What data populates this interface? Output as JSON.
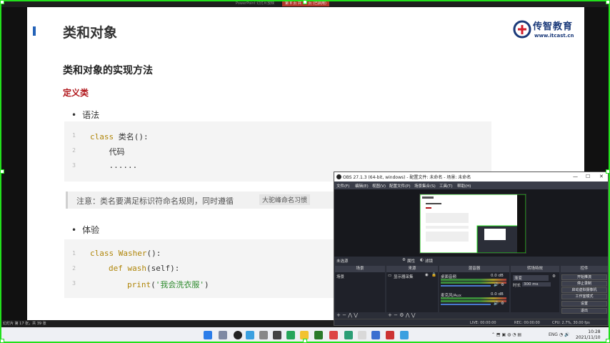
{
  "ppt": {
    "window_title": "PowerPoint 幻灯片放映",
    "active_tab": "第 8 页 共 39 页 (已启用)",
    "status": "幻灯片 第 17 张，共 39 张"
  },
  "slide": {
    "title": "类和对象",
    "logo_main": "传智教育",
    "logo_url": "www.itcast.cn",
    "heading": "类和对象的实现方法",
    "subheading": "定义类",
    "bullet_syntax": "语法",
    "code1": {
      "lines": [
        {
          "num": "1",
          "kw": "class ",
          "rest": "类名():"
        },
        {
          "num": "2",
          "kw": "",
          "rest": "    代码"
        },
        {
          "num": "3",
          "kw": "",
          "rest": "    ......"
        }
      ]
    },
    "note_text": "注意：类名要满足标识符命名规则，同时遵循",
    "note_tag": "大驼峰命名习惯",
    "bullet_experience": "体验",
    "code2": {
      "line1_num": "1",
      "line1_kw": "class ",
      "line1_name": "Washer",
      "line1_rest": "():",
      "line2_num": "2",
      "line2_kw": "def ",
      "line2_name": "wash",
      "line2_rest": "(self):",
      "line3_num": "3",
      "line3_fn": "print",
      "line3_open": "(",
      "line3_str": "'我会洗衣服'",
      "line3_close": ")"
    }
  },
  "obs": {
    "title": "OBS 27.1.3 (64-bit, windows) - 配置文件: 未命名 - 场景: 未命名",
    "menu": [
      "文件(F)",
      "编辑(E)",
      "视图(V)",
      "配置文件(P)",
      "场景集合(S)",
      "工具(T)",
      "帮助(H)"
    ],
    "toolbar_source": "未选源",
    "toolbar_props": "属性",
    "toolbar_filters": "滤镜",
    "docks": {
      "scenes": "场景",
      "sources": "来源",
      "mixer": "混音器",
      "transitions": "转场特效",
      "controls": "控件"
    },
    "scene_item": "场景",
    "source_item": "显示器采集",
    "mixer_track1": "桌面音频",
    "mixer_track1_db": "0.0 dB",
    "mixer_track2": "麦克风/Aux",
    "mixer_track2_db": "0.0 dB",
    "transition_type": "渐变",
    "duration_label": "时长",
    "duration_value": "300 ms",
    "buttons": [
      "开始推流",
      "停止录制",
      "启动虚拟摄像机",
      "工作室模式",
      "设置",
      "退出"
    ],
    "status": {
      "live": "LIVE: 00:00:00",
      "rec": "REC: 00:00:00",
      "cpu": "CPU: 2.7%, 30.00 fps"
    }
  },
  "taskbar": {
    "time": "10:28",
    "date": "2021/11/10"
  },
  "colors": {
    "accent": "#2563b8",
    "heading_red": "#b0151a",
    "capture_green": "#22e01c",
    "code_keyword": "#b0860a",
    "code_string": "#2e8b2e"
  }
}
